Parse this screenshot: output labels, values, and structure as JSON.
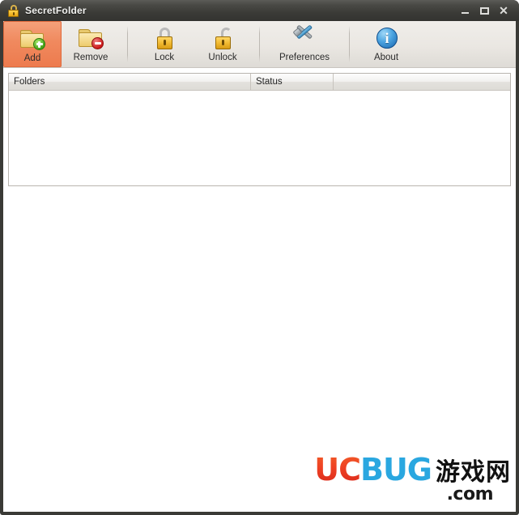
{
  "window": {
    "title": "SecretFolder",
    "title_icon": "padlock-icon",
    "controls": {
      "minimize": "–",
      "maximize": "□",
      "close": "✕"
    }
  },
  "toolbar": {
    "items": [
      {
        "label": "Add",
        "icon": "folder-add-icon",
        "active": true
      },
      {
        "label": "Remove",
        "icon": "folder-remove-icon",
        "active": false
      },
      {
        "label": "Lock",
        "icon": "lock-closed-icon",
        "active": false
      },
      {
        "label": "Unlock",
        "icon": "lock-open-icon",
        "active": false
      },
      {
        "label": "Preferences",
        "icon": "tools-icon",
        "active": false
      },
      {
        "label": "About",
        "icon": "info-icon",
        "active": false
      }
    ]
  },
  "list": {
    "columns": [
      {
        "label": "Folders"
      },
      {
        "label": "Status"
      },
      {
        "label": ""
      }
    ],
    "rows": []
  },
  "watermark": {
    "uc": "UC",
    "bug": "BUG",
    "cn": "游戏网",
    "com": ".com"
  },
  "colors": {
    "accent_orange": "#ed7b4e",
    "titlebar": "#3b3b37",
    "toolbar_bg": "#eae7e2",
    "wm_red": "#ef4a24",
    "wm_blue": "#2aa7e0"
  }
}
